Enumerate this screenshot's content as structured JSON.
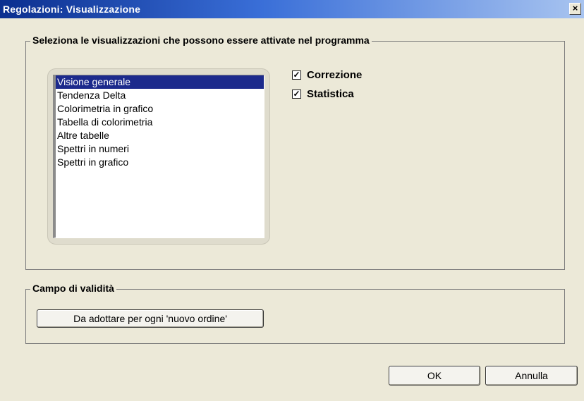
{
  "window": {
    "title": "Regolazioni: Visualizzazione",
    "close_label": "×"
  },
  "views_group": {
    "legend": "Seleziona le visualizzazioni che possono essere attivate nel programma",
    "list_items": [
      {
        "label": "Visione generale",
        "selected": true
      },
      {
        "label": "Tendenza Delta",
        "selected": false
      },
      {
        "label": "Colorimetria in grafico",
        "selected": false
      },
      {
        "label": "Tabella di colorimetria",
        "selected": false
      },
      {
        "label": "Altre tabelle",
        "selected": false
      },
      {
        "label": "Spettri in numeri",
        "selected": false
      },
      {
        "label": "Spettri in grafico",
        "selected": false
      }
    ],
    "checkboxes": [
      {
        "label": "Correzione",
        "checked": true
      },
      {
        "label": "Statistica",
        "checked": true
      }
    ]
  },
  "scope_group": {
    "legend": "Campo di validità",
    "button_label": "Da adottare per ogni 'nuovo ordine'"
  },
  "footer": {
    "ok_label": "OK",
    "cancel_label": "Annulla"
  },
  "colors": {
    "selection": "#1c2a8c",
    "dialog_background": "#ece9d8"
  }
}
